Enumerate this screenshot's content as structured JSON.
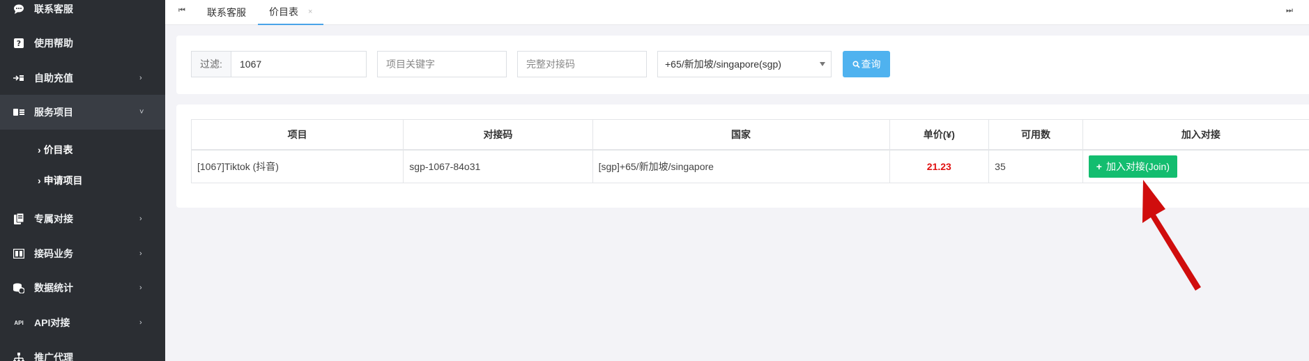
{
  "sidebar": {
    "items": [
      {
        "label": "联系客服",
        "icon": "chat-icon",
        "has_arrow": false
      },
      {
        "label": "使用帮助",
        "icon": "help-icon",
        "has_arrow": false
      },
      {
        "label": "自助充值",
        "icon": "recharge-icon",
        "has_arrow": true
      },
      {
        "label": "服务项目",
        "icon": "service-icon",
        "has_arrow": true,
        "expanded": true
      },
      {
        "label": "专属对接",
        "icon": "dedicated-icon",
        "has_arrow": true
      },
      {
        "label": "接码业务",
        "icon": "code-icon",
        "has_arrow": true
      },
      {
        "label": "数据统计",
        "icon": "stats-icon",
        "has_arrow": true
      },
      {
        "label": "API对接",
        "icon": "api-icon",
        "has_arrow": true
      },
      {
        "label": "推广代理",
        "icon": "promote-icon",
        "has_arrow": false
      }
    ],
    "sub_items": [
      {
        "label": "价目表"
      },
      {
        "label": "申请项目"
      }
    ],
    "sub_prefix": "›",
    "api_icon_text": "API"
  },
  "tabs": {
    "items": [
      {
        "label": "联系客服",
        "active": false
      },
      {
        "label": "价目表",
        "active": true
      }
    ],
    "close_glyph": "×",
    "prev_glyph": "⏮",
    "next_glyph": "⏭"
  },
  "filter": {
    "label": "过滤:",
    "value": "1067",
    "keyword_placeholder": "项目关键字",
    "code_placeholder": "完整对接码",
    "country_selected": "+65/新加坡/singapore(sgp)",
    "query_label": "查询"
  },
  "table": {
    "headers": [
      "项目",
      "对接码",
      "国家",
      "单价(¥)",
      "可用数",
      "加入对接"
    ],
    "rows": [
      {
        "project": "[1067]Tiktok (抖音)",
        "code": "sgp-1067-84o31",
        "country": "[sgp]+65/新加坡/singapore",
        "price": "21.23",
        "available": "35",
        "action": "加入对接(Join)"
      }
    ]
  },
  "colors": {
    "sidebar_bg": "#2b2e33",
    "accent_blue": "#4fb2ef",
    "join_green": "#13bd6f",
    "price_red": "#e01010",
    "arrow_red": "#d00d0d"
  }
}
